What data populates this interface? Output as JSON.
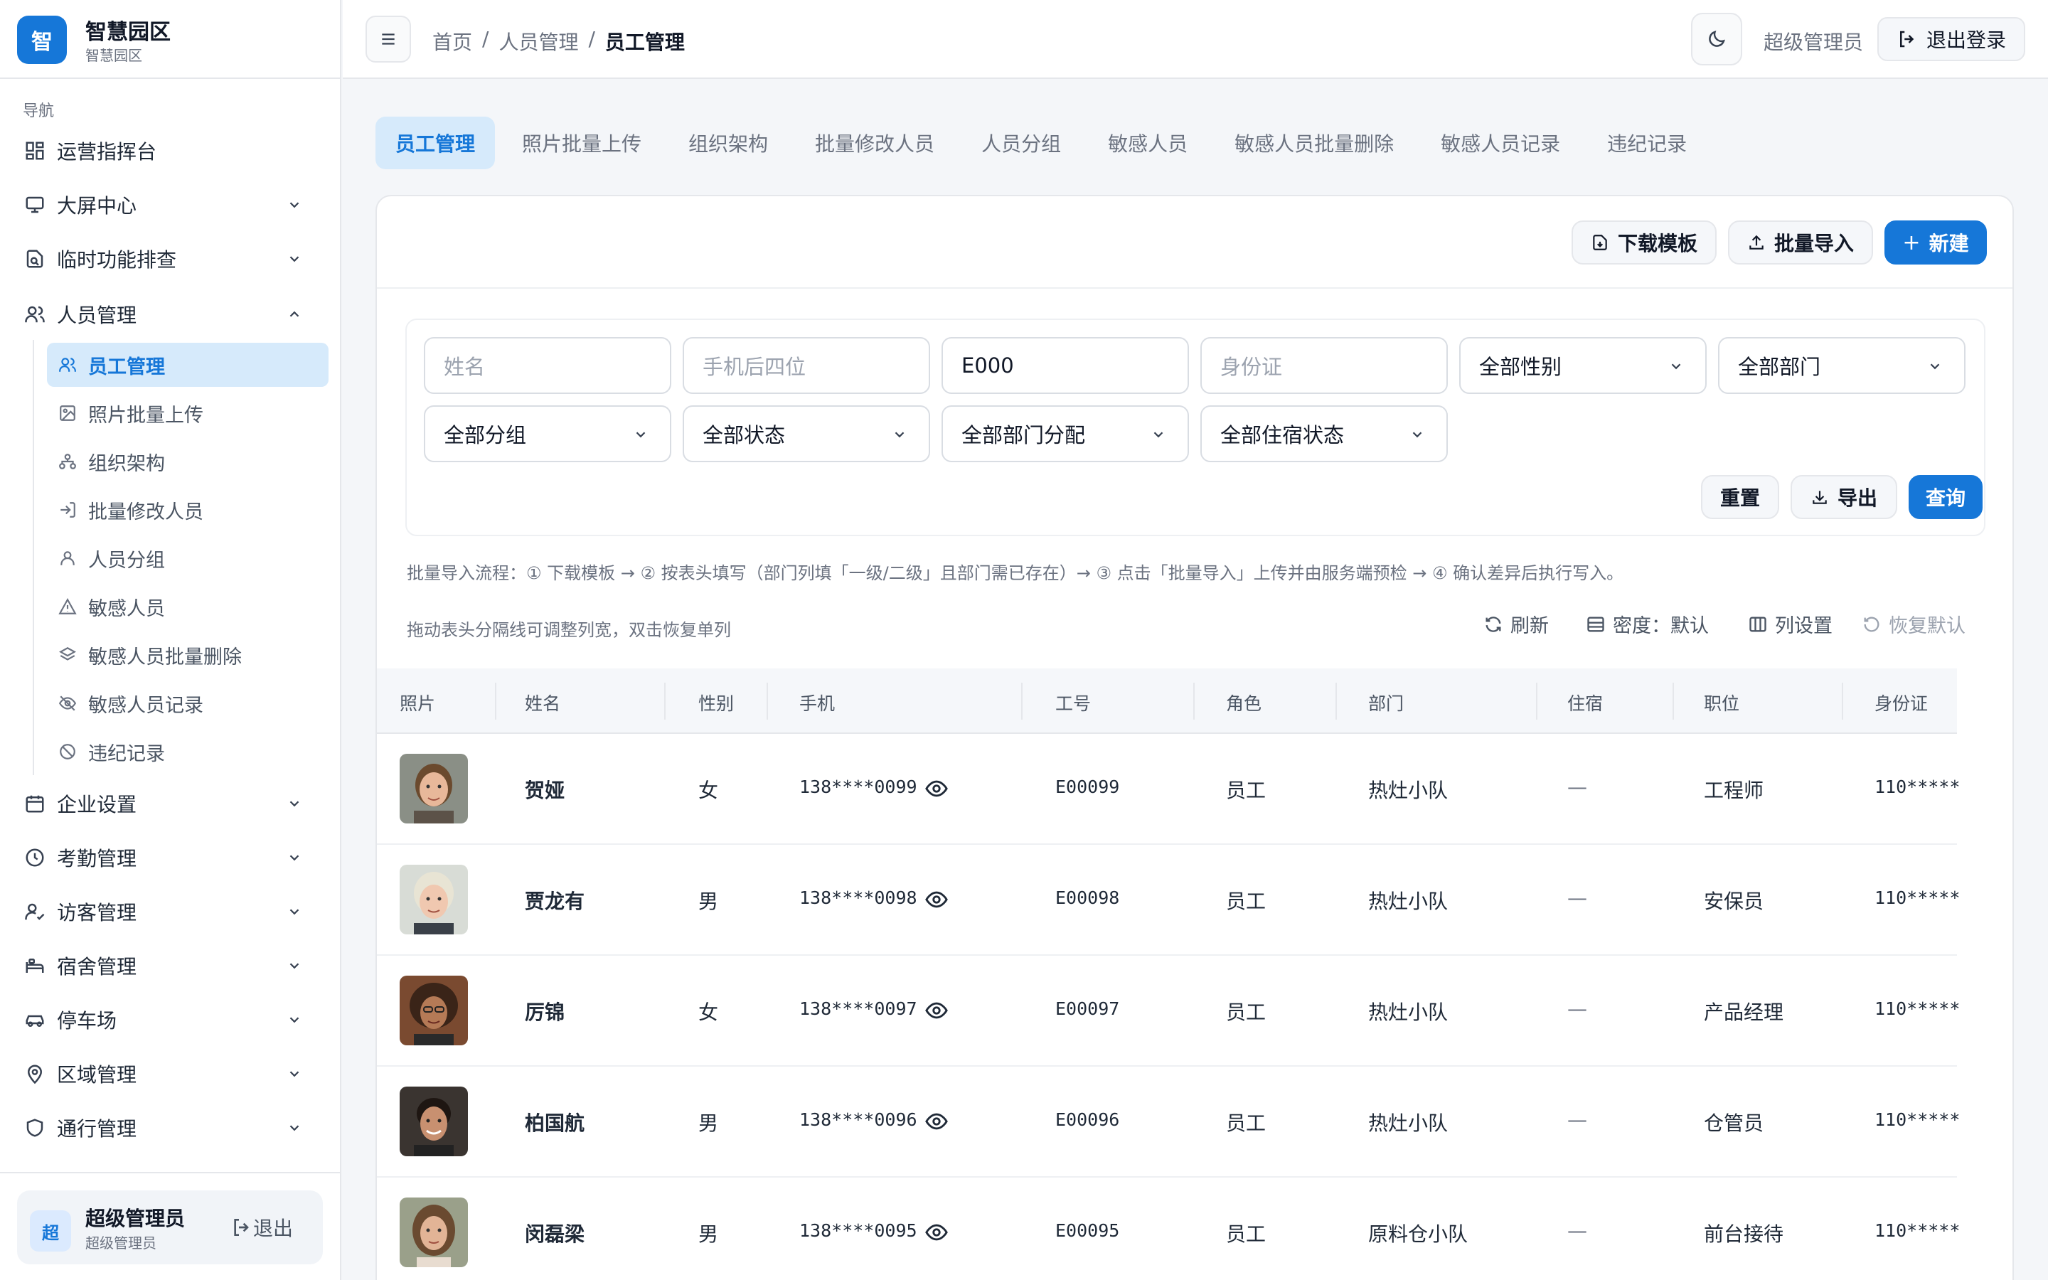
{
  "brand": {
    "logo_char": "智",
    "title": "智慧园区",
    "subtitle": "智慧园区"
  },
  "nav": {
    "caption": "导航",
    "items": [
      {
        "label": "运营指挥台",
        "icon": "dashboard-icon"
      },
      {
        "label": "大屏中心",
        "icon": "monitor-icon"
      },
      {
        "label": "临时功能排查",
        "icon": "file-search-icon"
      },
      {
        "label": "人员管理",
        "icon": "users-icon"
      },
      {
        "label": "企业设置",
        "icon": "calendar-icon"
      },
      {
        "label": "考勤管理",
        "icon": "clock-icon"
      },
      {
        "label": "访客管理",
        "icon": "user-check-icon"
      },
      {
        "label": "宿舍管理",
        "icon": "bed-icon"
      },
      {
        "label": "停车场",
        "icon": "car-icon"
      },
      {
        "label": "区域管理",
        "icon": "map-pin-icon"
      },
      {
        "label": "通行管理",
        "icon": "shield-icon"
      }
    ],
    "sub_items": [
      {
        "label": "员工管理",
        "icon": "users-icon"
      },
      {
        "label": "照片批量上传",
        "icon": "image-icon"
      },
      {
        "label": "组织架构",
        "icon": "org-icon"
      },
      {
        "label": "批量修改人员",
        "icon": "import-icon"
      },
      {
        "label": "人员分组",
        "icon": "user-icon"
      },
      {
        "label": "敏感人员",
        "icon": "warning-icon"
      },
      {
        "label": "敏感人员批量删除",
        "icon": "layers-icon"
      },
      {
        "label": "敏感人员记录",
        "icon": "eye-off-icon"
      },
      {
        "label": "违纪记录",
        "icon": "ban-icon"
      }
    ]
  },
  "user": {
    "avatar": "超",
    "name": "超级管理员",
    "role": "超级管理员",
    "logout": "退出"
  },
  "header": {
    "breadcrumb": [
      "首页",
      "/",
      "人员管理",
      "/",
      "员工管理"
    ],
    "user": "超级管理员",
    "logout": "退出登录"
  },
  "tabs": [
    "员工管理",
    "照片批量上传",
    "组织架构",
    "批量修改人员",
    "人员分组",
    "敏感人员",
    "敏感人员批量删除",
    "敏感人员记录",
    "违纪记录"
  ],
  "toolbar": {
    "download": "下载模板",
    "import": "批量导入",
    "create": "新建"
  },
  "filters": {
    "name_ph": "姓名",
    "phone_ph": "手机后四位",
    "emp_no": "E000",
    "id_ph": "身份证",
    "gender": "全部性别",
    "dept": "全部部门",
    "group": "全部分组",
    "status": "全部状态",
    "dept_assign": "全部部门分配",
    "dorm": "全部住宿状态",
    "reset": "重置",
    "export": "导出",
    "query": "查询"
  },
  "hint": "批量导入流程：① 下载模板 → ② 按表头填写（部门列填「一级/二级」且部门需已存在）→ ③ 点击「批量导入」上传并由服务端预检 → ④ 确认差异后执行写入。",
  "table_hint": "拖动表头分隔线可调整列宽，双击恢复单列",
  "table_tools": {
    "refresh": "刷新",
    "density": "密度：默认",
    "columns": "列设置",
    "restore": "恢复默认"
  },
  "columns": [
    "照片",
    "姓名",
    "性别",
    "手机",
    "工号",
    "角色",
    "部门",
    "住宿",
    "职位",
    "身份证"
  ],
  "rows": [
    {
      "name": "贺娅",
      "gender": "女",
      "phone": "138****0099",
      "emp": "E00099",
      "role": "员工",
      "dept": "热灶小队",
      "dorm": "—",
      "position": "工程师",
      "id": "110*****"
    },
    {
      "name": "贾龙有",
      "gender": "男",
      "phone": "138****0098",
      "emp": "E00098",
      "role": "员工",
      "dept": "热灶小队",
      "dorm": "—",
      "position": "安保员",
      "id": "110*****"
    },
    {
      "name": "厉锦",
      "gender": "女",
      "phone": "138****0097",
      "emp": "E00097",
      "role": "员工",
      "dept": "热灶小队",
      "dorm": "—",
      "position": "产品经理",
      "id": "110*****"
    },
    {
      "name": "柏国航",
      "gender": "男",
      "phone": "138****0096",
      "emp": "E00096",
      "role": "员工",
      "dept": "热灶小队",
      "dorm": "—",
      "position": "仓管员",
      "id": "110*****"
    },
    {
      "name": "闵磊梁",
      "gender": "男",
      "phone": "138****0095",
      "emp": "E00095",
      "role": "员工",
      "dept": "原料仓小队",
      "dorm": "—",
      "position": "前台接待",
      "id": "110*****"
    }
  ],
  "colors": {
    "primary": "#1677d8",
    "active_bg": "#d6eafb"
  }
}
